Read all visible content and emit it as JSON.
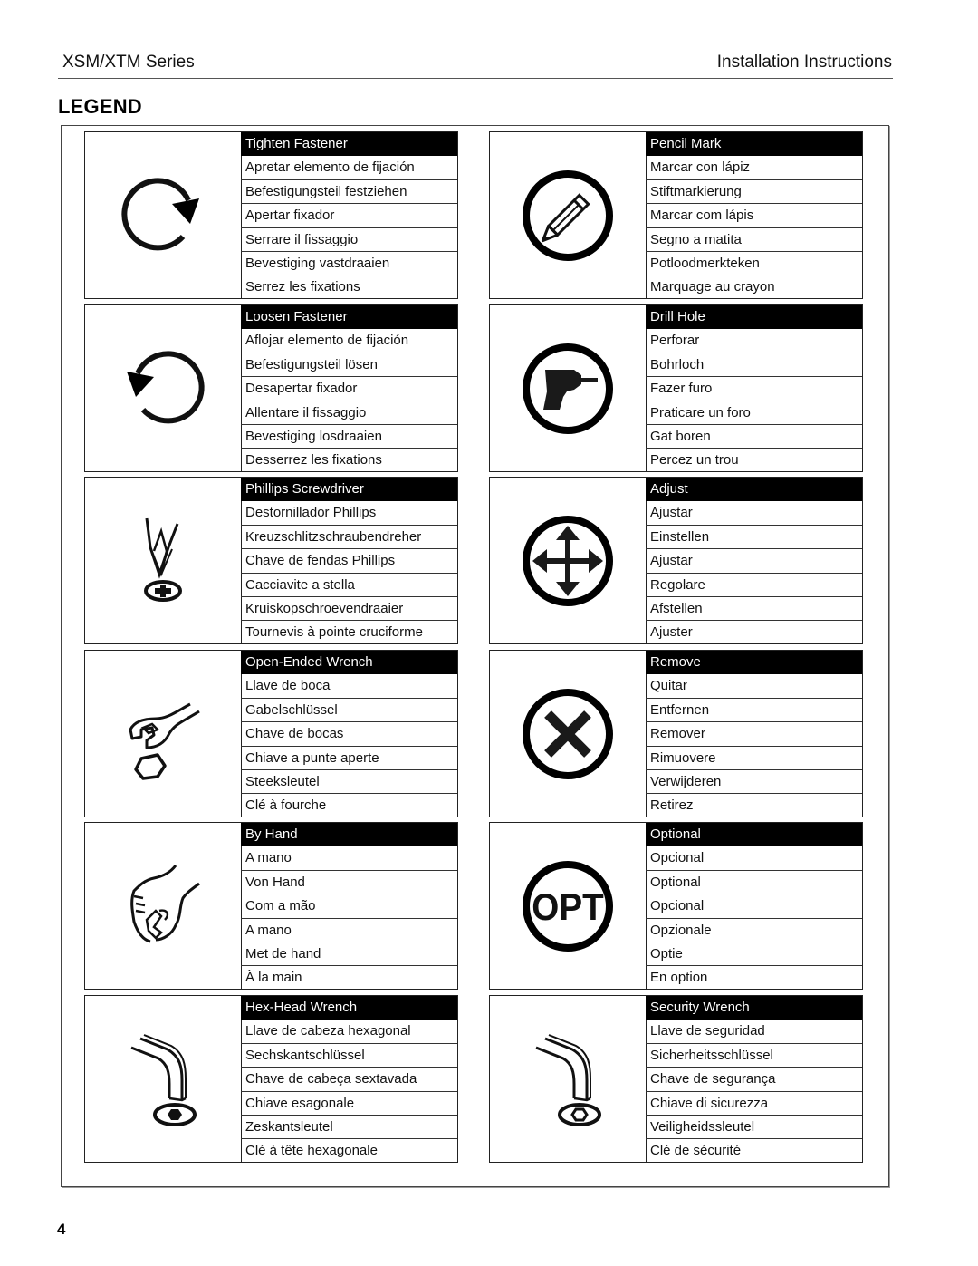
{
  "header": {
    "series": "XSM/XTM Series",
    "doc_type": "Installation Instructions"
  },
  "legend_title": "LEGEND",
  "legend": {
    "left": [
      {
        "icon": "tighten-fastener-icon",
        "title": "Tighten Fastener",
        "translations": [
          "Apretar elemento de fijación",
          "Befestigungsteil festziehen",
          "Apertar fixador",
          "Serrare il fissaggio",
          "Bevestiging vastdraaien",
          "Serrez les fixations"
        ]
      },
      {
        "icon": "loosen-fastener-icon",
        "title": "Loosen Fastener",
        "translations": [
          "Aflojar elemento de fijación",
          "Befestigungsteil lösen",
          "Desapertar fixador",
          "Allentare il fissaggio",
          "Bevestiging losdraaien",
          "Desserrez les fixations"
        ]
      },
      {
        "icon": "phillips-screwdriver-icon",
        "title": "Phillips Screwdriver",
        "translations": [
          "Destornillador Phillips",
          "Kreuzschlitzschraubendreher",
          "Chave de fendas Phillips",
          "Cacciavite a stella",
          "Kruiskopschroevendraaier",
          "Tournevis à pointe cruciforme"
        ]
      },
      {
        "icon": "open-ended-wrench-icon",
        "title": "Open-Ended Wrench",
        "translations": [
          "Llave de boca",
          "Gabelschlüssel",
          "Chave de bocas",
          "Chiave a punte aperte",
          "Steeksleutel",
          "Clé à fourche"
        ]
      },
      {
        "icon": "by-hand-icon",
        "title": "By Hand",
        "translations": [
          "A mano",
          "Von Hand",
          "Com a mão",
          "A mano",
          "Met de hand",
          "À la main"
        ]
      },
      {
        "icon": "hex-head-wrench-icon",
        "title": "Hex-Head Wrench",
        "translations": [
          "Llave de cabeza hexagonal",
          "Sechskantschlüssel",
          "Chave de cabeça sextavada",
          "Chiave esagonale",
          "Zeskantsleutel",
          "Clé à tête hexagonale"
        ]
      }
    ],
    "right": [
      {
        "icon": "pencil-mark-icon",
        "title": "Pencil Mark",
        "translations": [
          "Marcar con lápiz",
          "Stiftmarkierung",
          "Marcar com lápis",
          "Segno a matita",
          "Potloodmerkteken",
          "Marquage au crayon"
        ]
      },
      {
        "icon": "drill-hole-icon",
        "title": "Drill Hole",
        "translations": [
          "Perforar",
          "Bohrloch",
          "Fazer furo",
          "Praticare un foro",
          "Gat boren",
          "Percez un trou"
        ]
      },
      {
        "icon": "adjust-icon",
        "title": "Adjust",
        "translations": [
          "Ajustar",
          "Einstellen",
          "Ajustar",
          "Regolare",
          "Afstellen",
          "Ajuster"
        ]
      },
      {
        "icon": "remove-icon",
        "title": "Remove",
        "translations": [
          "Quitar",
          "Entfernen",
          "Remover",
          "Rimuovere",
          "Verwijderen",
          "Retirez"
        ]
      },
      {
        "icon": "optional-icon",
        "title": "Optional",
        "icon_text": "OPT",
        "translations": [
          "Opcional",
          "Optional",
          "Opcional",
          "Opzionale",
          "Optie",
          "En option"
        ]
      },
      {
        "icon": "security-wrench-icon",
        "title": "Security Wrench",
        "translations": [
          "Llave de seguridad",
          "Sicherheitsschlüssel",
          "Chave de segurança",
          "Chiave di sicurezza",
          "Veiligheidssleutel",
          "Clé de sécurité"
        ]
      }
    ]
  },
  "page_number": "4"
}
